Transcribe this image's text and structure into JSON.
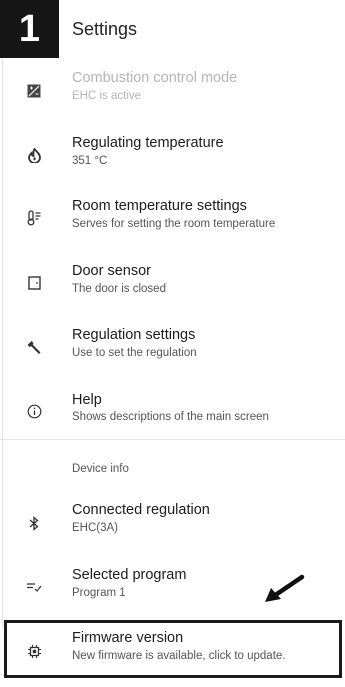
{
  "header": {
    "step": "1",
    "title": "Settings"
  },
  "items": [
    {
      "title": "Combustion control mode",
      "subtitle": "EHC is active",
      "icon": "combustion-mode-icon",
      "disabled": true
    },
    {
      "title": "Regulating temperature",
      "subtitle": "351 °C",
      "icon": "flame-icon"
    },
    {
      "title": "Room temperature settings",
      "subtitle": "Serves for setting the room temperature",
      "icon": "thermometer-icon"
    },
    {
      "title": "Door sensor",
      "subtitle": "The door is closed",
      "icon": "door-icon"
    },
    {
      "title": "Regulation settings",
      "subtitle": "Use to set the regulation",
      "icon": "wrench-icon"
    },
    {
      "title": "Help",
      "subtitle": "Shows descriptions of the main screen",
      "icon": "info-icon"
    }
  ],
  "device_info": {
    "section_label": "Device info",
    "items": [
      {
        "title": "Connected regulation",
        "subtitle": "EHC(3A)",
        "icon": "bluetooth-icon"
      },
      {
        "title": "Selected program",
        "subtitle": "Program 1",
        "icon": "playlist-check-icon"
      },
      {
        "title": "Firmware version",
        "subtitle": "New firmware is available, click to update.",
        "icon": "chip-icon"
      }
    ]
  }
}
